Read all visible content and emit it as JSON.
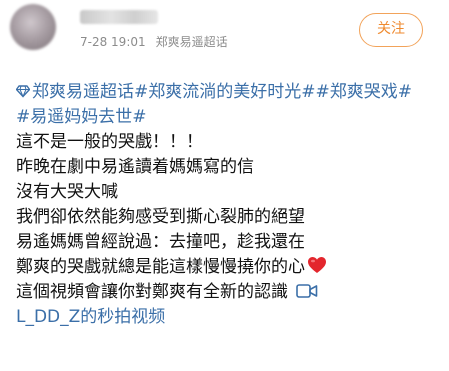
{
  "post": {
    "username": "",
    "time": "7-28 19:01",
    "source": "郑爽易遥超话",
    "follow_label": "关注"
  },
  "content": {
    "topics": [
      "郑爽易遥超话",
      "#郑爽流淌的美好时光#",
      "#郑爽哭戏#",
      "#易遥妈妈去世#"
    ],
    "lines": [
      "這不是一般的哭戲！！！",
      "昨晚在劇中易遙讀着媽媽寫的信",
      "沒有大哭大喊",
      "我們卻依然能夠感受到撕心裂肺的絕望",
      "易遙媽媽曾經說過：去撞吧，趁我還在",
      "鄭爽的哭戲就總是能這樣慢慢撓你的心",
      "這個視頻會讓你對鄭爽有全新的認識"
    ],
    "video_link": "L_DD_Z的秒拍视频"
  },
  "colors": {
    "link": "#3b6fa8",
    "follow": "#ef8a2f",
    "meta": "#8c8c8c"
  },
  "icons": [
    "avatar",
    "super-topic-diamond-icon",
    "heart-icon",
    "video-icon"
  ]
}
